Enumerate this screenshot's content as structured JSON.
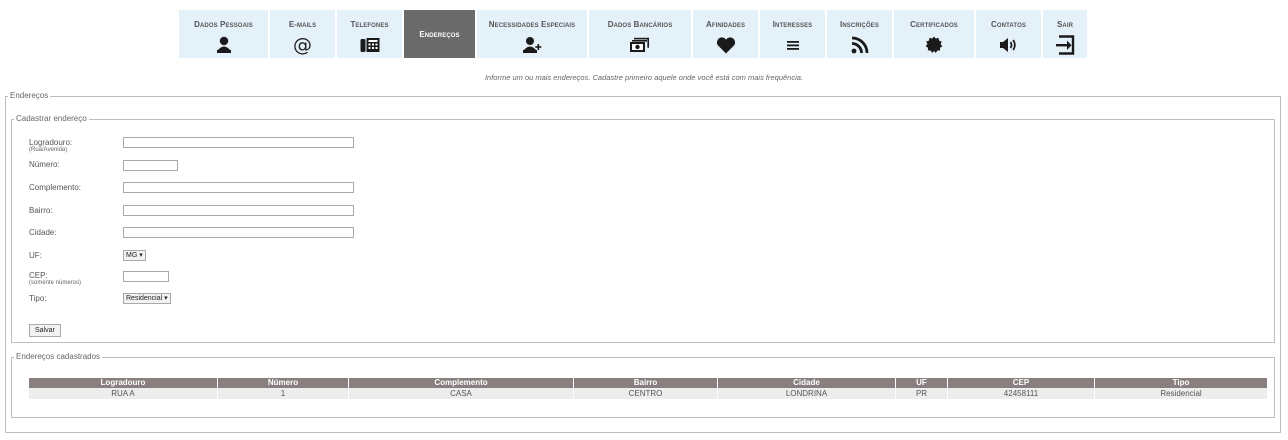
{
  "nav": {
    "items": [
      {
        "label": "Dados Pessoais",
        "icon": "person-icon"
      },
      {
        "label": "E-mails",
        "icon": "at-icon"
      },
      {
        "label": "Telefones",
        "icon": "fax-icon"
      },
      {
        "label": "Endereços",
        "icon": "",
        "active": true
      },
      {
        "label": "Necessidades Especiais",
        "icon": "person-add-icon"
      },
      {
        "label": "Dados Bancários",
        "icon": "money-icon"
      },
      {
        "label": "Afinidades",
        "icon": "heart-icon"
      },
      {
        "label": "Interesses",
        "icon": "list-icon"
      },
      {
        "label": "Inscrições",
        "icon": "rss-icon"
      },
      {
        "label": "Certificados",
        "icon": "badge-icon"
      },
      {
        "label": "Contatos",
        "icon": "volume-icon"
      },
      {
        "label": "Sair",
        "icon": "logout-icon"
      }
    ]
  },
  "hint": "Informe um ou mais endereços. Cadastre primeiro aquele onde você está com mais frequência.",
  "outer_legend": "Endereços",
  "form": {
    "legend": "Cadastrar endereço",
    "logradouro_label": "Logradouro:",
    "logradouro_sub": "(Rua/Avenida)",
    "numero_label": "Número:",
    "complemento_label": "Complemento:",
    "bairro_label": "Bairro:",
    "cidade_label": "Cidade:",
    "uf_label": "UF:",
    "uf_value": "MG ▾",
    "cep_label": "CEP:",
    "cep_sub": "(somente números)",
    "tipo_label": "Tipo:",
    "tipo_value": "Residencial ▾",
    "save_label": "Salvar"
  },
  "list": {
    "legend": "Endereços cadastrados",
    "columns": [
      "Logradouro",
      "Número",
      "Complemento",
      "Bairro",
      "Cidade",
      "UF",
      "CEP",
      "Tipo"
    ],
    "rows": [
      [
        "RUA A",
        "1",
        "CASA",
        "CENTRO",
        "LONDRINA",
        "PR",
        "42458111",
        "Residencial"
      ]
    ]
  },
  "colors": {
    "nav_bg": "#e4f1f8",
    "nav_active_bg": "#6a6a6a",
    "table_header_bg": "#8a7f7f",
    "table_row_bg": "#ededed"
  }
}
